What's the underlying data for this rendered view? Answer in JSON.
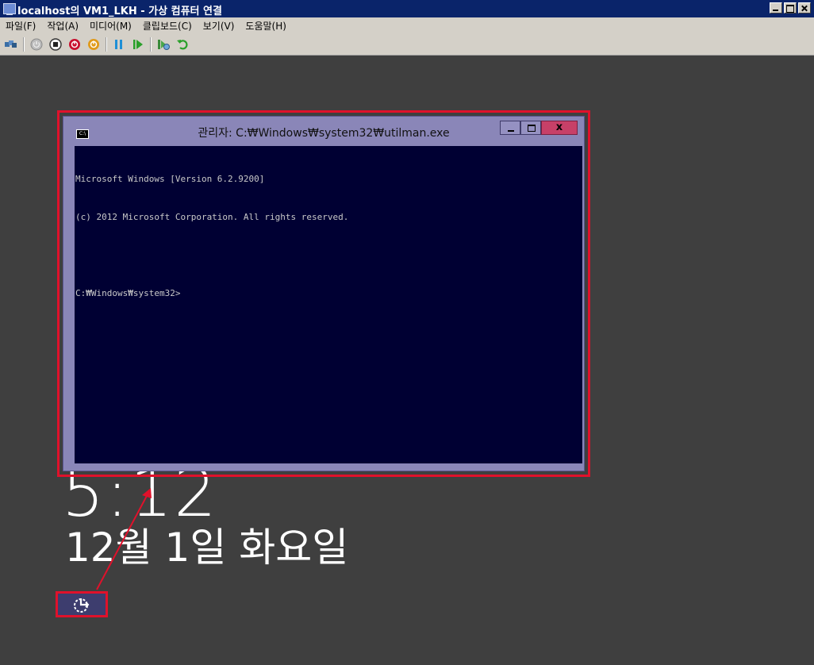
{
  "window": {
    "title": "localhost의 VM1_LKH - 가상 컴퓨터 연결",
    "controls": [
      "minimize-icon",
      "maximize-icon",
      "close-icon"
    ]
  },
  "menu": {
    "items": [
      "파일(F)",
      "작업(A)",
      "미디어(M)",
      "클립보드(C)",
      "보기(V)",
      "도움말(H)"
    ]
  },
  "toolbar": {
    "buttons": [
      {
        "name": "ctrl-alt-del-icon"
      },
      {
        "name": "start-icon"
      },
      {
        "name": "turn-off-icon"
      },
      {
        "name": "shutdown-icon"
      },
      {
        "name": "save-state-icon"
      },
      {
        "name": "pause-icon"
      },
      {
        "name": "resume-icon"
      },
      {
        "name": "snapshot-icon"
      },
      {
        "name": "revert-icon"
      }
    ]
  },
  "lockscreen": {
    "clock": "5:12",
    "date": "12월 1일 화요일",
    "ease_of_access_icon": "ease-of-access-icon"
  },
  "cmd": {
    "title": "관리자: C:₩Windows₩system32₩utilman.exe",
    "lines": [
      "Microsoft Windows [Version 6.2.9200]",
      "(c) 2012 Microsoft Corporation. All rights reserved.",
      "",
      "C:₩Windows₩system32>"
    ]
  },
  "colors": {
    "highlight": "#e0112b",
    "console_bg": "#000033",
    "cmd_frame": "#8a86b8"
  }
}
